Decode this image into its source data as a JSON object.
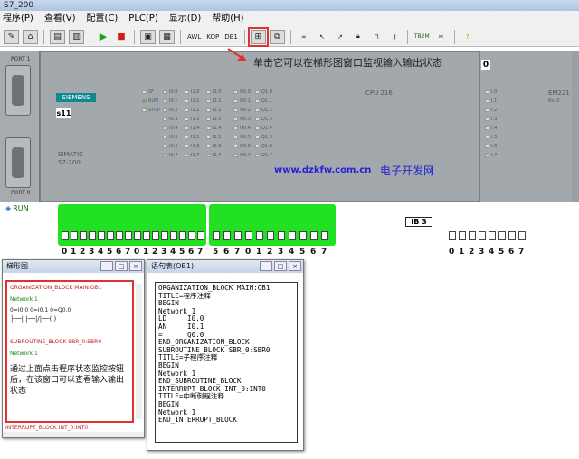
{
  "window": {
    "title": "S7_200"
  },
  "menu": [
    "程序(P)",
    "查看(V)",
    "配置(C)",
    "PLC(P)",
    "显示(D)",
    "帮助(H)"
  ],
  "toolbar": {
    "awl_label": "AWL",
    "kop_label": "KOP",
    "db1_label": "DB1",
    "tb_label": "TB2M"
  },
  "plc": {
    "port1_label": "PORT 1",
    "port0_label": "PORT 0",
    "brand": "SIEMENS",
    "module_name": "s11",
    "simatic": "SIMATIC",
    "model": "S7-200",
    "cpu_label": "CPU 216",
    "em_label": "EM221",
    "em_sub": "8x10",
    "status_leds": [
      "SF",
      "RUN",
      "STOP"
    ],
    "input_leds_a": [
      "I0.0",
      "I0.1",
      "I0.2",
      "I0.3",
      "I0.4",
      "I0.5",
      "I0.6",
      "I0.7"
    ],
    "input_leds_b": [
      "I1.0",
      "I1.1",
      "I1.2",
      "I1.3",
      "I1.4",
      "I1.5",
      "I1.6",
      "I1.7"
    ],
    "input_leds_c": [
      "I2.0",
      "I2.1",
      "I2.2",
      "I2.3",
      "I2.4",
      "I2.5",
      "I2.6",
      "I2.7"
    ],
    "output_leds_a": [
      "Q0.0",
      "Q0.1",
      "Q0.2",
      "Q0.3",
      "Q0.4",
      "Q0.5",
      "Q0.6",
      "Q0.7"
    ],
    "output_leds_b": [
      "Q1.0",
      "Q1.1",
      "Q1.2",
      "Q1.3",
      "Q1.4",
      "Q1.5",
      "Q1.6",
      "Q1.7"
    ],
    "em_leds": [
      "I.0",
      "I.1",
      "I.2",
      "I.3",
      "I.4",
      "I.5",
      "I.6",
      "I.7"
    ]
  },
  "annotation_text": "单击它可以在梯形图窗口监视输入输出状态",
  "zero_value": "0",
  "watermark_url": "www.dzkfw.com.cn",
  "watermark_site": "电子开发网",
  "run_label": "RUN",
  "switch_numbers_left": [
    "0",
    "1",
    "2",
    "3",
    "4",
    "5",
    "6",
    "7",
    "0",
    "1",
    "2",
    "3",
    "4",
    "5",
    "6",
    "7"
  ],
  "switch_numbers_right": [
    "5",
    "6",
    "7",
    "0",
    "1",
    "2",
    "3",
    "4",
    "5",
    "6",
    "7"
  ],
  "ib_label": "IB 3",
  "switch_numbers_ib3": [
    "0",
    "1",
    "2",
    "3",
    "4",
    "5",
    "6",
    "7"
  ],
  "ladder_window": {
    "title": "梯形图",
    "block1": "ORGANIZATION_BLOCK MAIN:OB1",
    "network": "Network 1",
    "contacts": "0=I0.0    0=I0.1    0=Q0.0",
    "block2": "SUBROUTINE_BLOCK SBR_0:SBR0",
    "network2": "Network 1",
    "note": "通过上面点击程序状态监控按钮后，在该窗口可以查看输入输出状态",
    "block3": "INTERRUPT_BLOCK INT_0:INT0"
  },
  "statement_window": {
    "title": "语句表(OB1)",
    "code": "ORGANIZATION_BLOCK MAIN:OB1\nTITLE=程序注释\nBEGIN\nNetwork 1\nLD     I0.0\nAN     I0.1\n=      Q0.0\nEND_ORGANIZATION_BLOCK\nSUBROUTINE_BLOCK SBR_0:SBR0\nTITLE=子程序注释\nBEGIN\nNetwork 1\nEND_SUBROUTINE_BLOCK\nINTERRUPT_BLOCK INT_0:INT0\nTITLE=中断例程注释\nBEGIN\nNetwork 1\nEND_INTERRUPT_BLOCK"
  }
}
